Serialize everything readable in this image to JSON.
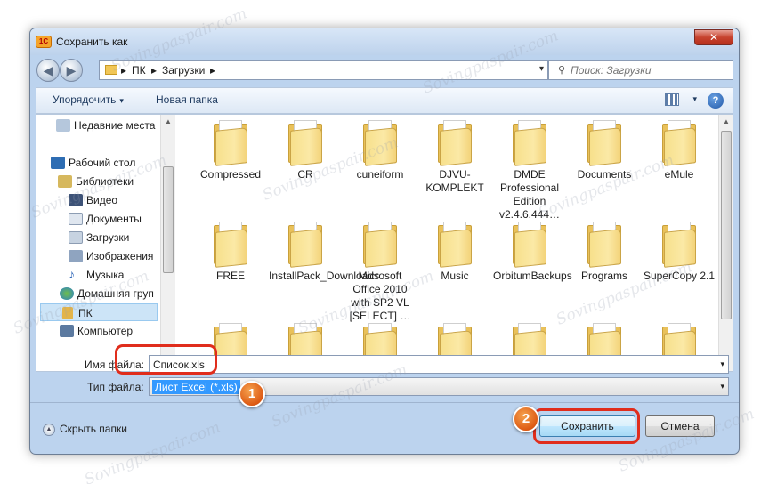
{
  "window": {
    "title": "Сохранить как",
    "close_glyph": "✕"
  },
  "address": {
    "crumbs": [
      "ПК",
      "Загрузки"
    ],
    "separator": "▸",
    "dropdown_glyph": "▾",
    "refresh_glyph": "⟲",
    "search_placeholder": "Поиск: Загрузки"
  },
  "nav_buttons": {
    "back_glyph": "◀",
    "forward_glyph": "▶"
  },
  "toolbar": {
    "organize_label": "Упорядочить",
    "new_folder_label": "Новая папка",
    "caret": "▾",
    "help_label": "?"
  },
  "sidebar": {
    "items": [
      {
        "label": "Недавние места",
        "icon": "recent-places-icon"
      },
      {
        "label": "Рабочий стол",
        "icon": "desktop-icon"
      },
      {
        "label": "Библиотеки",
        "icon": "libraries-icon"
      },
      {
        "label": "Видео",
        "icon": "video-icon"
      },
      {
        "label": "Документы",
        "icon": "documents-icon"
      },
      {
        "label": "Загрузки",
        "icon": "downloads-icon"
      },
      {
        "label": "Изображения",
        "icon": "pictures-icon"
      },
      {
        "label": "Музыка",
        "icon": "music-icon"
      },
      {
        "label": "Домашняя груп",
        "icon": "homegroup-icon"
      },
      {
        "label": "ПК",
        "icon": "pc-icon"
      },
      {
        "label": "Компьютер",
        "icon": "computer-icon"
      }
    ],
    "selected": "ПК"
  },
  "files": [
    {
      "name": "Compressed",
      "icon": "folder-icon"
    },
    {
      "name": "CR",
      "icon": "folder-icon"
    },
    {
      "name": "cuneiform",
      "icon": "folder-icon"
    },
    {
      "name": "DJVU-KOMPLEKT",
      "icon": "folder-icon"
    },
    {
      "name": "DMDE Professional Edition v2.4.6.444…",
      "icon": "folder-icon"
    },
    {
      "name": "Documents",
      "icon": "folder-icon"
    },
    {
      "name": "eMule",
      "icon": "folder-icon"
    },
    {
      "name": "FREE",
      "icon": "folder-icon"
    },
    {
      "name": "InstallPack_Downloads",
      "icon": "folder-icon"
    },
    {
      "name": "Microsoft Office 2010 with SP2 VL [SELECT] …",
      "icon": "folder-icon"
    },
    {
      "name": "Music",
      "icon": "folder-icon"
    },
    {
      "name": "OrbitumBackups",
      "icon": "folder-icon"
    },
    {
      "name": "Programs",
      "icon": "folder-icon"
    },
    {
      "name": "SuperCopy 2.1",
      "icon": "folder-icon"
    },
    {
      "name": "",
      "icon": "folder-icon"
    },
    {
      "name": "",
      "icon": "folder-icon"
    },
    {
      "name": "",
      "icon": "folder-icon"
    },
    {
      "name": "",
      "icon": "folder-icon"
    },
    {
      "name": "",
      "icon": "folder-icon"
    },
    {
      "name": "",
      "icon": "folder-icon"
    },
    {
      "name": "",
      "icon": "folder-icon"
    }
  ],
  "form": {
    "filename_label": "Имя файла:",
    "filename_value": "Список.xls",
    "filetype_label": "Тип файла:",
    "filetype_value": "Лист Excel (*.xls)",
    "dropdown_glyph": "▾"
  },
  "footer": {
    "hide_folders_label": "Скрыть папки",
    "save_label": "Сохранить",
    "cancel_label": "Отмена"
  },
  "annotations": {
    "badge_1": "1",
    "badge_2": "2",
    "highlight_color": "#e02d1c",
    "badge_color": "#dd5a14"
  },
  "scrollbar": {
    "up_glyph": "▲",
    "down_glyph": "▼"
  },
  "watermark": "Sovingpaspair.com"
}
